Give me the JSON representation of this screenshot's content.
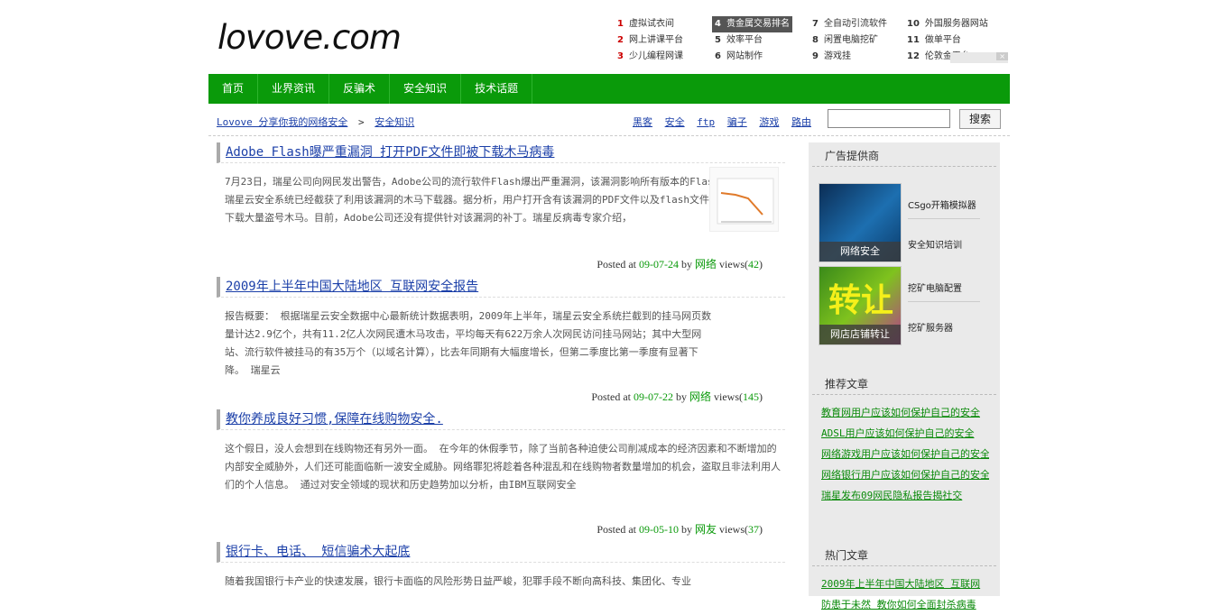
{
  "logo": "lovove.com",
  "toplinks": [
    [
      {
        "n": "1",
        "t": "虚拟试衣间",
        "red": true
      },
      {
        "n": "2",
        "t": "网上讲课平台",
        "red": true
      },
      {
        "n": "3",
        "t": "少儿编程网课",
        "red": true
      }
    ],
    [
      {
        "n": "4",
        "t": "贵金属交易排名",
        "hl": true
      },
      {
        "n": "5",
        "t": "效率平台"
      },
      {
        "n": "6",
        "t": "网站制作"
      }
    ],
    [
      {
        "n": "7",
        "t": "全自动引流软件"
      },
      {
        "n": "8",
        "t": "闲置电脑挖矿"
      },
      {
        "n": "9",
        "t": "游戏挂"
      }
    ],
    [
      {
        "n": "10",
        "t": "外国服务器网站"
      },
      {
        "n": "11",
        "t": "做单平台"
      },
      {
        "n": "12",
        "t": "伦敦金平台"
      }
    ]
  ],
  "nav": [
    "首页",
    "业界资讯",
    "反骗术",
    "安全知识",
    "技术话题"
  ],
  "breadcrumb": {
    "home": "Lovove 分享你我的网络安全",
    "sep": ">",
    "current": "安全知识"
  },
  "tags": [
    "黑客",
    "安全",
    "ftp",
    "骗子",
    "游戏",
    "路由"
  ],
  "search": {
    "button": "搜索"
  },
  "posts": [
    {
      "title": "Adobe Flash曝严重漏洞 打开PDF文件即被下载木马病毒",
      "body": "7月23日，瑞星公司向网民发出警告，Adobe公司的流行软件Flash爆出严重漏洞，该漏洞影响所有版本的Flash、PDF程序，瑞星云安全系统已经截获了利用该漏洞的木马下载器。据分析，用户打开含有该漏洞的PDF文件以及flash文件后，电脑会自动下载大量盗号木马。目前，Adobe公司还没有提供针对该漏洞的补丁。瑞星反病毒专家介绍，",
      "date": "09-07-24",
      "author": "网络",
      "views": "42"
    },
    {
      "title": "2009年上半年中国大陆地区 互联网安全报告",
      "body": "报告概要： 根据瑞星云安全数据中心最新统计数据表明，2009年上半年，瑞星云安全系统拦截到的挂马网页数量计达2.9亿个，共有11.2亿人次网民遭木马攻击，平均每天有622万余人次网民访问挂马网站；其中大型网站、流行软件被挂马的有35万个（以域名计算），比去年同期有大幅度增长，但第二季度比第一季度有显著下降。 瑞星云",
      "date": "09-07-22",
      "author": "网络",
      "views": "145"
    },
    {
      "title": "教你养成良好习惯,保障在线购物安全.",
      "body": "这个假日，没人会想到在线购物还有另外一面。 在今年的休假季节，除了当前各种迫使公司削减成本的经济因素和不断增加的内部安全威胁外，人们还可能面临新一波安全威胁。网络罪犯将趁着各种混乱和在线购物者数量增加的机会，盗取且非法利用人们的个人信息。 通过对安全领域的现状和历史趋势加以分析，由IBM互联网安全",
      "date": "09-05-10",
      "author": "网友",
      "views": "37"
    },
    {
      "title": "银行卡、电话、 短信骗术大起底",
      "body": "随着我国银行卡产业的快速发展，银行卡面临的风险形势日益严峻，犯罪手段不断向高科技、集团化、专业"
    }
  ],
  "meta": {
    "posted": "Posted at",
    "by": "by",
    "views": "views"
  },
  "sidebar": {
    "ads_title": "广告提供商",
    "ads": [
      {
        "cap": "网络安全",
        "links": [
          "CSgo开箱模拟器",
          "安全知识培训"
        ]
      },
      {
        "cap": "网店店铺转让",
        "links": [
          "挖矿电脑配置",
          "挖矿服务器"
        ]
      }
    ],
    "recommend_title": "推荐文章",
    "recommend": [
      "教育网用户应该如何保护自己的安全",
      "ADSL用户应该如何保护自己的安全",
      "网络游戏用户应该如何保护自己的安全",
      "网络银行用户应该如何保护自己的安全",
      "瑞星发布09网民隐私报告揭社交"
    ],
    "hot_title": "热门文章",
    "hot": [
      "2009年上半年中国大陆地区 互联网",
      "防患于未然 教你如何全面封杀病毒"
    ]
  }
}
